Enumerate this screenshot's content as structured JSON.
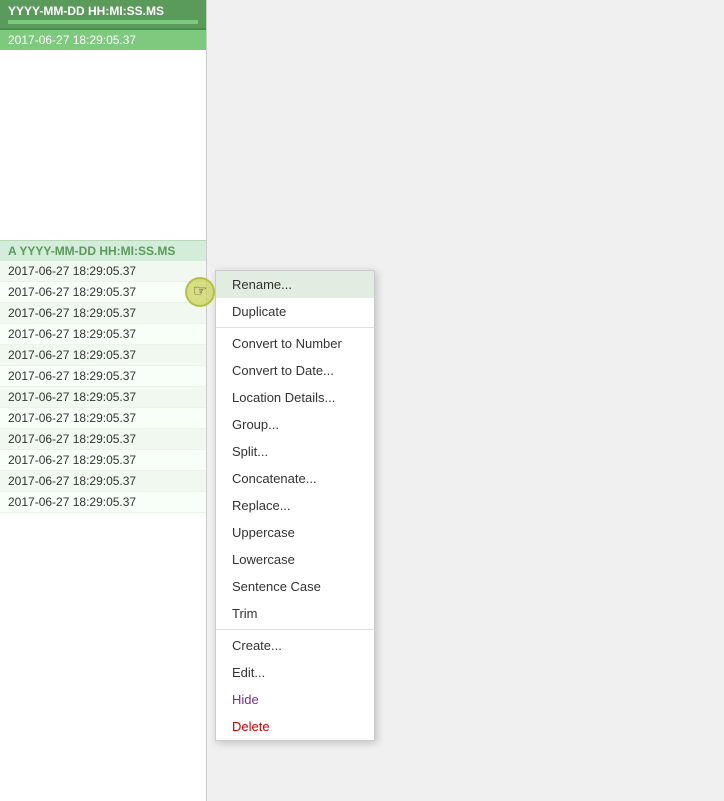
{
  "column": {
    "header_label": "YYYY-MM-DD HH:MI:SS.MS",
    "sample_value": "2017-06-27 18:29:05.37",
    "column_type_label": "A  YYYY-MM-DD HH:MI:SS.MS",
    "data_rows": [
      "2017-06-27 18:29:05.37",
      "2017-06-27 18:29:05.37",
      "2017-06-27 18:29:05.37",
      "2017-06-27 18:29:05.37",
      "2017-06-27 18:29:05.37",
      "2017-06-27 18:29:05.37",
      "2017-06-27 18:29:05.37",
      "2017-06-27 18:29:05.37",
      "2017-06-27 18:29:05.37",
      "2017-06-27 18:29:05.37",
      "2017-06-27 18:29:05.37",
      "2017-06-27 18:29:05.37"
    ]
  },
  "context_menu": {
    "items": [
      {
        "label": "Rename...",
        "style": "normal",
        "active": true
      },
      {
        "label": "Duplicate",
        "style": "normal",
        "active": false
      },
      {
        "label": "Convert to Number",
        "style": "normal",
        "active": false
      },
      {
        "label": "Convert to Date...",
        "style": "normal",
        "active": false
      },
      {
        "label": "Location Details...",
        "style": "normal",
        "active": false
      },
      {
        "label": "Group...",
        "style": "normal",
        "active": false
      },
      {
        "label": "Split...",
        "style": "normal",
        "active": false
      },
      {
        "label": "Concatenate...",
        "style": "normal",
        "active": false
      },
      {
        "label": "Replace...",
        "style": "normal",
        "active": false
      },
      {
        "label": "Uppercase",
        "style": "normal",
        "active": false
      },
      {
        "label": "Lowercase",
        "style": "normal",
        "active": false
      },
      {
        "label": "Sentence Case",
        "style": "normal",
        "active": false
      },
      {
        "label": "Trim",
        "style": "normal",
        "active": false
      },
      {
        "label": "Create...",
        "style": "normal",
        "active": false
      },
      {
        "label": "Edit...",
        "style": "normal",
        "active": false
      },
      {
        "label": "Hide",
        "style": "purple",
        "active": false
      },
      {
        "label": "Delete",
        "style": "red",
        "active": false
      }
    ]
  }
}
